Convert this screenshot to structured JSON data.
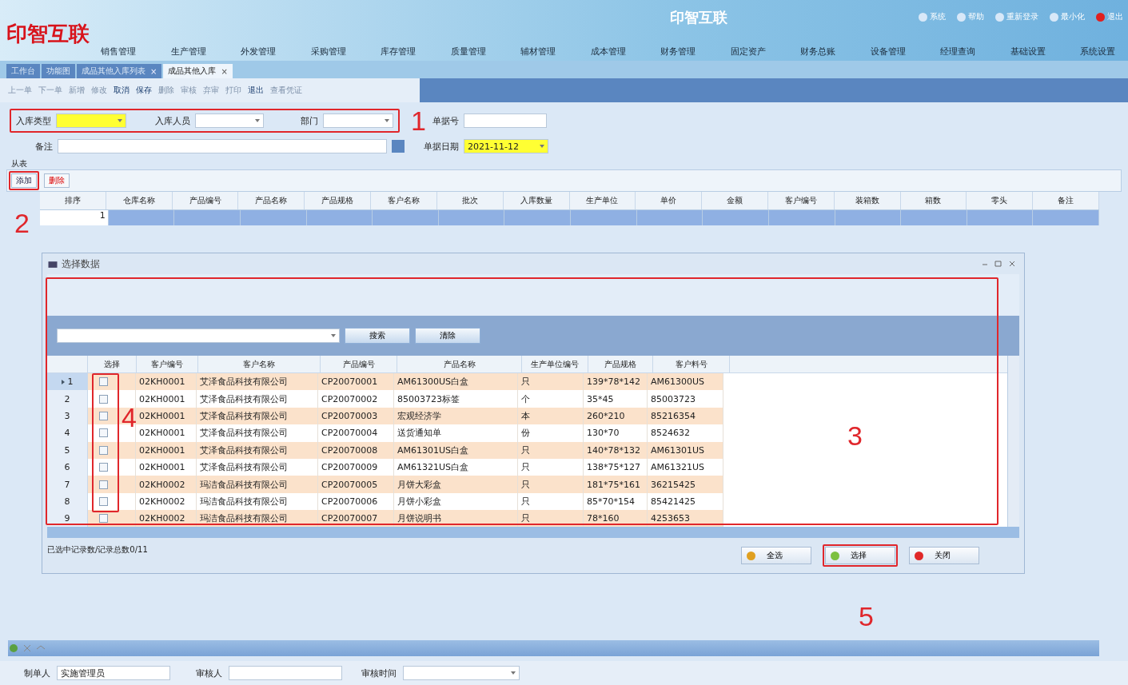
{
  "app": {
    "logo": "印智互联",
    "title": "印智互联"
  },
  "top_links": [
    "系统",
    "帮助",
    "重新登录",
    "最小化",
    "退出"
  ],
  "menu": [
    "销售管理",
    "生产管理",
    "外发管理",
    "采购管理",
    "库存管理",
    "质量管理",
    "辅材管理",
    "成本管理",
    "财务管理",
    "固定资产",
    "财务总账",
    "设备管理",
    "经理查询",
    "基础设置",
    "系统设置"
  ],
  "doc_tabs": [
    {
      "label": "工作台",
      "selected": false
    },
    {
      "label": "功能图",
      "selected": false
    },
    {
      "label": "成品其他入库列表",
      "selected": false,
      "close": "×"
    },
    {
      "label": "成品其他入库",
      "selected": true,
      "close": "×"
    }
  ],
  "toolbar": [
    {
      "label": "上一单",
      "disabled": true
    },
    {
      "label": "下一单",
      "disabled": true
    },
    {
      "label": "新增",
      "disabled": true
    },
    {
      "label": "修改",
      "disabled": true
    },
    {
      "label": "取消",
      "disabled": false
    },
    {
      "label": "保存",
      "disabled": false
    },
    {
      "label": "删除",
      "disabled": true
    },
    {
      "label": "审核",
      "disabled": true
    },
    {
      "label": "弃审",
      "disabled": true
    },
    {
      "label": "打印",
      "disabled": true
    },
    {
      "label": "退出",
      "disabled": false
    },
    {
      "label": "查看凭证",
      "disabled": true
    }
  ],
  "form": {
    "type_label": "入库类型",
    "person_label": "入库人员",
    "dept_label": "部门",
    "doc_no_label": "单据号",
    "note_label": "备注",
    "date_label": "单据日期",
    "date_value": "2021-11-12"
  },
  "detail": {
    "tab": "从表",
    "add": "添加",
    "delete": "删除",
    "columns": [
      "排序",
      "仓库名称",
      "产品编号",
      "产品名称",
      "产品规格",
      "客户名称",
      "批次",
      "入库数量",
      "生产单位",
      "单价",
      "金额",
      "客户编号",
      "装箱数",
      "箱数",
      "零头",
      "备注"
    ],
    "rows": [
      {
        "index": "1",
        "selected": true
      }
    ]
  },
  "dialog": {
    "title": "选择数据",
    "search_button": "搜索",
    "clear_button": "清除",
    "check_column": "选择",
    "columns": [
      "客户编号",
      "客户名称",
      "产品编号",
      "产品名称",
      "生产单位编号",
      "产品规格",
      "客户料号"
    ],
    "rows": [
      {
        "index": "1",
        "selected": true,
        "checked": false,
        "cells": [
          "02KH0001",
          "艾泽食品科技有限公司",
          "CP20070001",
          "AM61300US白盒",
          "只",
          "139*78*142",
          "AM61300US"
        ]
      },
      {
        "index": "2",
        "selected": false,
        "checked": false,
        "cells": [
          "02KH0001",
          "艾泽食品科技有限公司",
          "CP20070002",
          "85003723标签",
          "个",
          "35*45",
          "85003723"
        ]
      },
      {
        "index": "3",
        "selected": false,
        "checked": false,
        "cells": [
          "02KH0001",
          "艾泽食品科技有限公司",
          "CP20070003",
          "宏观经济学",
          "本",
          "260*210",
          "85216354"
        ]
      },
      {
        "index": "4",
        "selected": false,
        "checked": false,
        "cells": [
          "02KH0001",
          "艾泽食品科技有限公司",
          "CP20070004",
          "送货通知单",
          "份",
          "130*70",
          "8524632"
        ]
      },
      {
        "index": "5",
        "selected": false,
        "checked": false,
        "cells": [
          "02KH0001",
          "艾泽食品科技有限公司",
          "CP20070008",
          "AM61301US白盒",
          "只",
          "140*78*132",
          "AM61301US"
        ]
      },
      {
        "index": "6",
        "selected": false,
        "checked": false,
        "cells": [
          "02KH0001",
          "艾泽食品科技有限公司",
          "CP20070009",
          "AM61321US白盒",
          "只",
          "138*75*127",
          "AM61321US"
        ]
      },
      {
        "index": "7",
        "selected": false,
        "checked": false,
        "cells": [
          "02KH0002",
          "玛洁食品科技有限公司",
          "CP20070005",
          "月饼大彩盒",
          "只",
          "181*75*161",
          "36215425"
        ]
      },
      {
        "index": "8",
        "selected": false,
        "checked": false,
        "cells": [
          "02KH0002",
          "玛洁食品科技有限公司",
          "CP20070006",
          "月饼小彩盒",
          "只",
          "85*70*154",
          "85421425"
        ]
      },
      {
        "index": "9",
        "selected": false,
        "checked": false,
        "cells": [
          "02KH0002",
          "玛洁食品科技有限公司",
          "CP20070007",
          "月饼说明书",
          "只",
          "78*160",
          "4253653"
        ]
      }
    ],
    "status": "已选中记录数/记录总数0/11",
    "select_all": "全选",
    "select": "选择",
    "close": "关闭"
  },
  "footer": {
    "maker_label": "制单人",
    "maker_value": "实施管理员",
    "auditor_label": "审核人",
    "audit_time_label": "审核时间"
  },
  "annotations": [
    {
      "label": "1"
    },
    {
      "label": "2"
    },
    {
      "label": "3"
    },
    {
      "label": "4"
    },
    {
      "label": "5"
    }
  ]
}
